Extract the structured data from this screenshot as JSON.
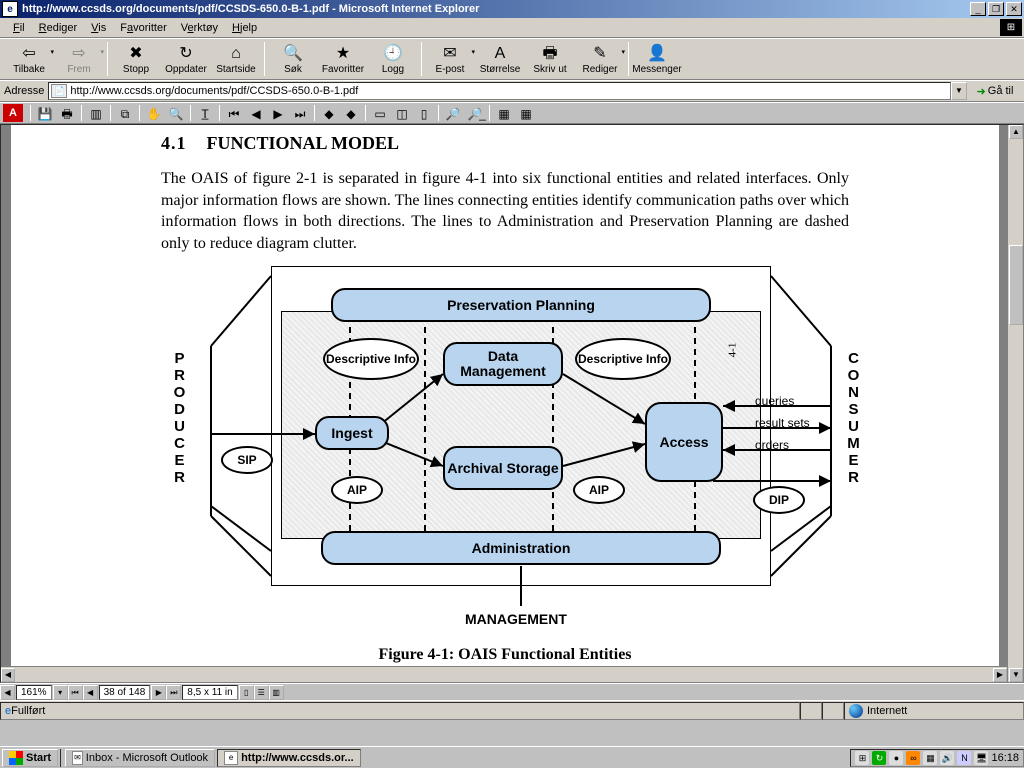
{
  "window": {
    "title": "http://www.ccsds.org/documents/pdf/CCSDS-650.0-B-1.pdf - Microsoft Internet Explorer"
  },
  "menu": {
    "fil": "Fil",
    "rediger": "Rediger",
    "vis": "Vis",
    "favoritter": "Favoritter",
    "verktoy": "Verktøy",
    "hjelp": "Hjelp"
  },
  "toolbar": {
    "tilbake": "Tilbake",
    "frem": "Frem",
    "stopp": "Stopp",
    "oppdater": "Oppdater",
    "startside": "Startside",
    "sok": "Søk",
    "favoritter": "Favoritter",
    "logg": "Logg",
    "epost": "E-post",
    "storrelse": "Størrelse",
    "skrivut": "Skriv ut",
    "rediger": "Rediger",
    "messenger": "Messenger"
  },
  "address": {
    "label": "Adresse",
    "url": "http://www.ccsds.org/documents/pdf/CCSDS-650.0-B-1.pdf",
    "go": "Gå til"
  },
  "pdf_status": {
    "zoom": "161%",
    "page": "38 of 148",
    "size": "8,5 x 11 in"
  },
  "document": {
    "sec_no": "4.1",
    "sec_title": "FUNCTIONAL MODEL",
    "para1": "The OAIS of figure 2-1 is separated in figure 4-1 into six functional entities and related interfaces.  Only major information flows are shown.  The lines connecting entities identify communication paths over which information flows in both directions.  The lines to Administration and Preservation Planning are dashed only to reduce diagram clutter.",
    "caption": "Figure 4-1:  OAIS Functional Entities",
    "page_mark": "4-1"
  },
  "diagram": {
    "producer": "PRODUCER",
    "consumer": "CONSUMER",
    "management": "MANAGEMENT",
    "preservation": "Preservation Planning",
    "data_mgmt": "Data Management",
    "ingest": "Ingest",
    "archival": "Archival Storage",
    "access": "Access",
    "admin": "Administration",
    "desc_info": "Descriptive Info",
    "sip": "SIP",
    "aip": "AIP",
    "dip": "DIP",
    "queries": "queries",
    "results": "result sets",
    "orders": "orders"
  },
  "ie_status": {
    "done": "Fullført",
    "zone": "Internett"
  },
  "taskbar": {
    "start": "Start",
    "outlook": "Inbox - Microsoft Outlook",
    "ie": "http://www.ccsds.or...",
    "clock": "16:18"
  }
}
